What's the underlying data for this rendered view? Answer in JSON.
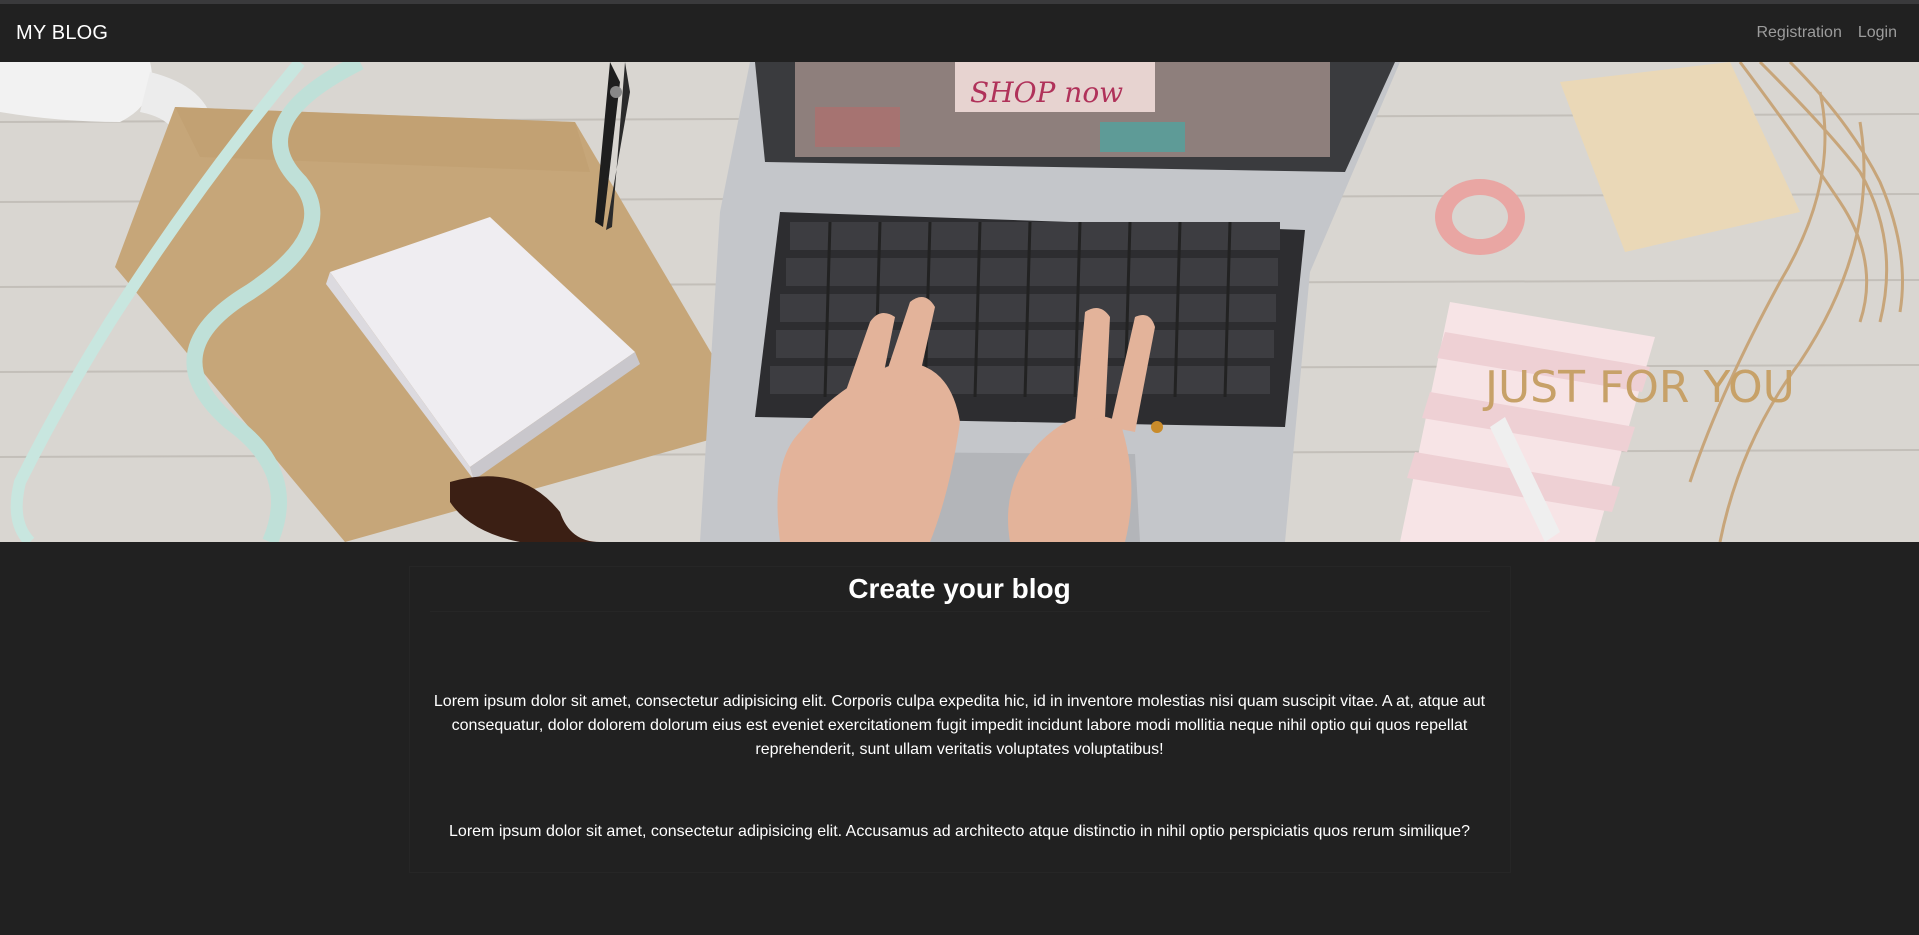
{
  "navbar": {
    "brand": "MY BLOG",
    "links": [
      "Registration",
      "Login"
    ]
  },
  "hero": {
    "image": "laptop-desk-flatlay",
    "screen_text": "SHOP now",
    "notebook_text": "JUST FOR YOU"
  },
  "main": {
    "title": "Create your blog",
    "paragraphs": [
      "Lorem ipsum dolor sit amet, consectetur adipisicing elit. Corporis culpa expedita hic, id in inventore molestias nisi quam suscipit vitae. A at, atque aut consequatur, dolor dolorem dolorum eius est eveniet exercitationem fugit impedit incidunt labore modi mollitia neque nihil optio qui quos repellat reprehenderit, sunt ullam veritatis voluptates voluptatibus!",
      "Lorem ipsum dolor sit amet, consectetur adipisicing elit. Accusamus ad architecto atque distinctio in nihil optio perspiciatis quos rerum similique?"
    ]
  },
  "colors": {
    "background": "#212121",
    "text": "#ffffff",
    "nav_link": "#9c9c9c"
  }
}
